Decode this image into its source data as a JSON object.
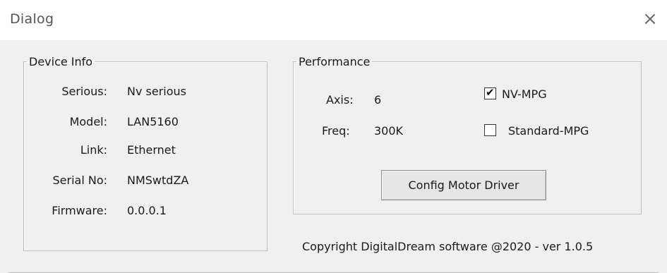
{
  "window": {
    "title": "Dialog",
    "close_icon": "×"
  },
  "device_info": {
    "legend": "Device Info",
    "rows": [
      {
        "label": "Serious:",
        "value": "Nv serious"
      },
      {
        "label": "Model:",
        "value": "LAN5160"
      },
      {
        "label": "Link:",
        "value": "Ethernet"
      },
      {
        "label": "Serial No:",
        "value": "NMSwtdZA"
      },
      {
        "label": "Firmware:",
        "value": "0.0.0.1"
      }
    ]
  },
  "performance": {
    "legend": "Performance",
    "axis_label": "Axis:",
    "axis_value": "6",
    "freq_label": "Freq:",
    "freq_value": "300K",
    "nv_mpg": {
      "label": "NV-MPG",
      "checked": true,
      "mark": "✔"
    },
    "standard_mpg": {
      "label": "Standard-MPG",
      "checked": false
    },
    "config_button": "Config Motor Driver"
  },
  "footer": {
    "copyright": "Copyright DigitalDream software @2020 - ver 1.0.5"
  }
}
